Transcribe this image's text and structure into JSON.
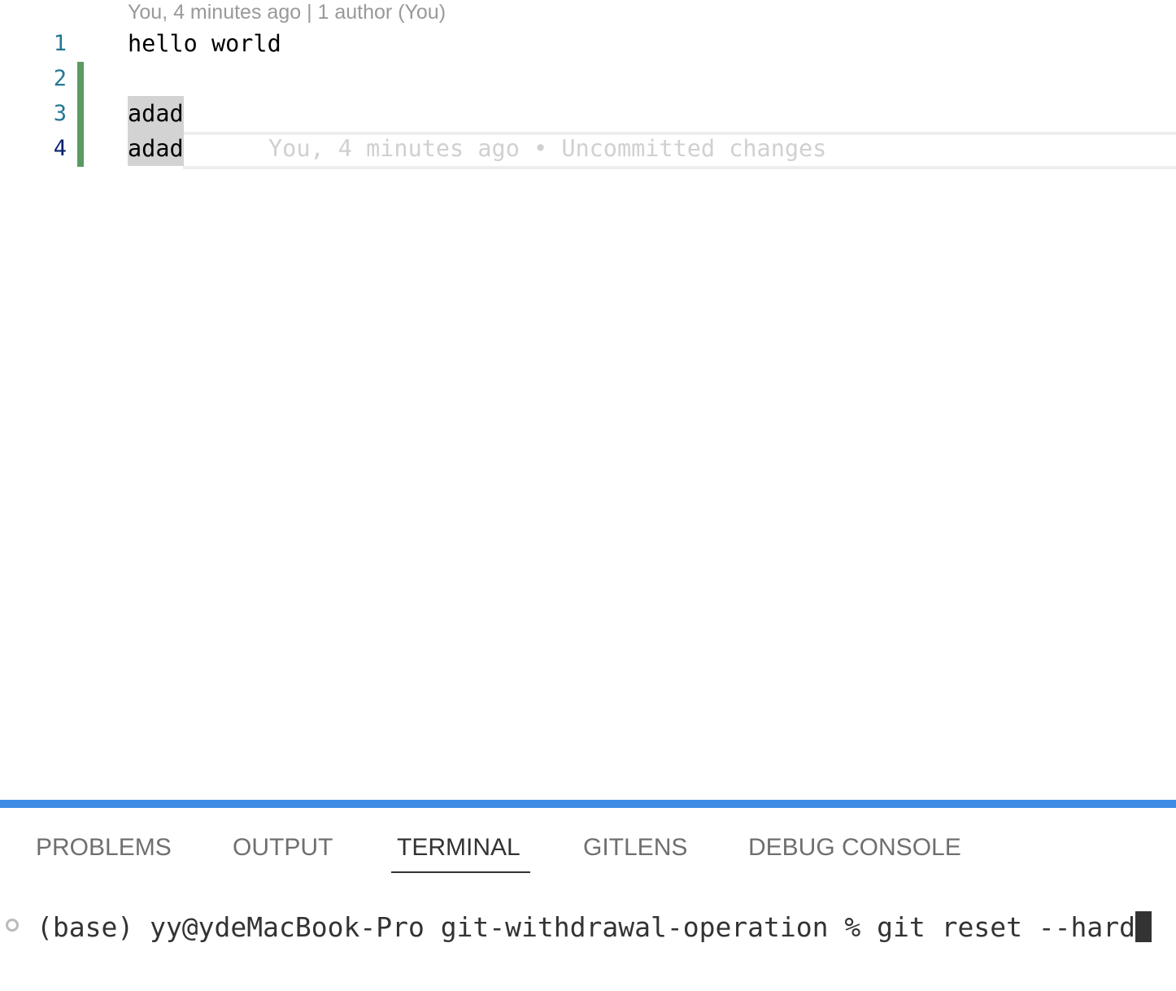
{
  "editor": {
    "blame_header": "You, 4 minutes ago | 1 author (You)",
    "lines": [
      {
        "number": "1",
        "text": "hello world"
      },
      {
        "number": "2",
        "text": ""
      },
      {
        "number": "3",
        "text": "adad"
      },
      {
        "number": "4",
        "text": "adad"
      }
    ],
    "inline_blame": "You, 4 minutes ago • Uncommitted changes",
    "added_lines_color": "#5a9a63"
  },
  "panel": {
    "tabs": [
      {
        "label": "PROBLEMS"
      },
      {
        "label": "OUTPUT"
      },
      {
        "label": "TERMINAL",
        "active": true
      },
      {
        "label": "GITLENS"
      },
      {
        "label": "DEBUG CONSOLE"
      }
    ],
    "accent_color": "#3f8ce5"
  },
  "terminal": {
    "prompt": "(base) yy@ydeMacBook-Pro git-withdrawal-operation % ",
    "command": "git reset --hard"
  }
}
